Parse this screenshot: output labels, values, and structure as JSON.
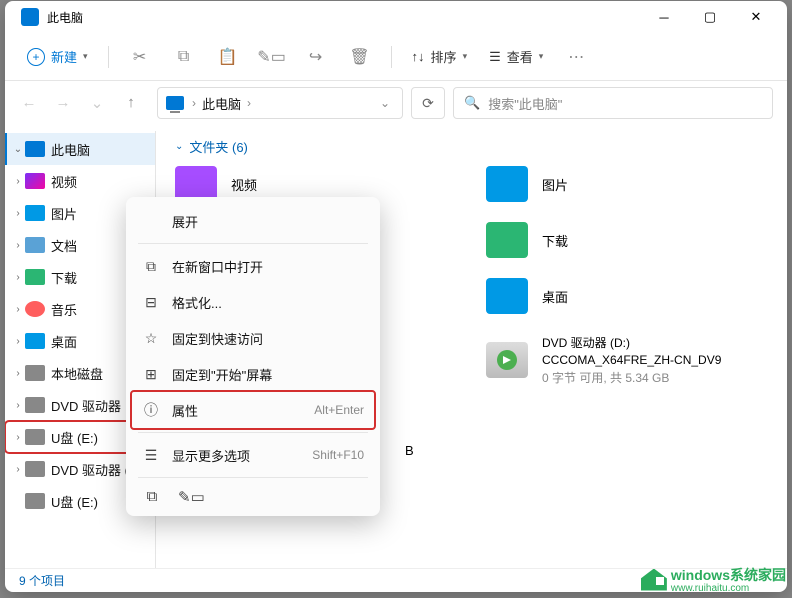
{
  "title": "此电脑",
  "toolbar": {
    "new_label": "新建",
    "sort_label": "排序",
    "view_label": "查看"
  },
  "address": {
    "crumb": "此电脑"
  },
  "search": {
    "placeholder": "搜索\"此电脑\""
  },
  "sidebar": {
    "items": [
      {
        "label": "此电脑",
        "icon_bg": "#0078d4"
      },
      {
        "label": "视频",
        "icon_bg": "linear-gradient(135deg,#7b2ff7,#f107a3)"
      },
      {
        "label": "图片",
        "icon_bg": "#0099e5"
      },
      {
        "label": "文档",
        "icon_bg": "#5aa2d6"
      },
      {
        "label": "下载",
        "icon_bg": "#2bb673"
      },
      {
        "label": "音乐",
        "icon_bg": "#ff5e5e"
      },
      {
        "label": "桌面",
        "icon_bg": "#0099e5"
      },
      {
        "label": "本地磁盘",
        "icon_bg": "#888"
      },
      {
        "label": "DVD 驱动器",
        "icon_bg": "#888"
      },
      {
        "label": "U盘 (E:)",
        "icon_bg": "#888"
      },
      {
        "label": "DVD 驱动器 (D:)",
        "icon_bg": "#888"
      },
      {
        "label": "U盘 (E:)",
        "icon_bg": "#888"
      }
    ]
  },
  "main": {
    "group_header": "文件夹 (6)",
    "items": [
      {
        "label": "视频",
        "color": "#a64dff"
      },
      {
        "label": "图片",
        "color": "#0099e5"
      },
      {
        "label": "下载",
        "color": "#2bb673"
      },
      {
        "label": "桌面",
        "color": "#0099e5"
      }
    ],
    "ghost_char": "B",
    "dvd": {
      "title": "DVD 驱动器 (D:)",
      "sub1": "CCCOMA_X64FRE_ZH-CN_DV9",
      "sub2": "0 字节 可用, 共 5.34 GB"
    }
  },
  "context_menu": {
    "expand": "展开",
    "new_window": "在新窗口中打开",
    "format": "格式化...",
    "pin_quick": "固定到快速访问",
    "pin_start": "固定到\"开始\"屏幕",
    "properties": "属性",
    "properties_shortcut": "Alt+Enter",
    "more_options": "显示更多选项",
    "more_options_shortcut": "Shift+F10"
  },
  "status": {
    "items_count": "9 个项目"
  },
  "watermark": {
    "text1": "windows系统家园",
    "text2": "www.ruihaitu.com"
  }
}
